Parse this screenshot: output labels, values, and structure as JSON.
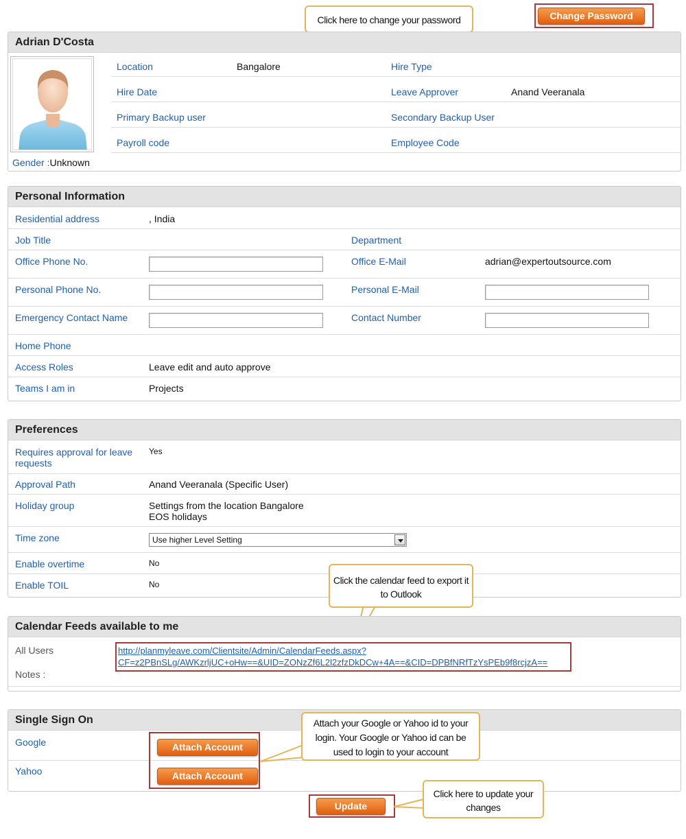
{
  "top": {
    "change_password_label": "Change Password",
    "callout_change_password": "Click here to change your password"
  },
  "profile": {
    "name": "Adrian D'Costa",
    "gender_label": "Gender :",
    "gender_value": "Unknown",
    "rows": [
      {
        "left_label": "Location",
        "left_value": "Bangalore",
        "right_label": "Hire Type",
        "right_value": ""
      },
      {
        "left_label": "Hire Date",
        "left_value": "",
        "right_label": "Leave Approver",
        "right_value": "Anand Veeranala"
      },
      {
        "left_label": "Primary Backup user",
        "left_value": "",
        "right_label": "Secondary Backup User",
        "right_value": ""
      },
      {
        "left_label": "Payroll code",
        "left_value": "",
        "right_label": "Employee Code",
        "right_value": ""
      }
    ]
  },
  "personal": {
    "title": "Personal Information",
    "residential_label": "Residential address",
    "residential_value": ", India",
    "job_title_label": "Job Title",
    "department_label": "Department",
    "office_phone_label": "Office Phone No.",
    "office_email_label": "Office E-Mail",
    "office_email_value": "adrian@expertoutsource.com",
    "personal_phone_label": "Personal Phone No.",
    "personal_email_label": "Personal E-Mail",
    "emergency_label": "Emergency Contact Name",
    "contact_number_label": "Contact Number",
    "home_phone_label": "Home Phone",
    "access_roles_label": "Access Roles",
    "access_roles_value": "Leave edit and auto approve",
    "teams_label": "Teams I am in",
    "teams_value": "Projects"
  },
  "preferences": {
    "title": "Preferences",
    "approval_label_1": "Requires approval for leave",
    "approval_label_2": "requests",
    "approval_value": "Yes",
    "approval_path_label": "Approval Path",
    "approval_path_value": "Anand Veeranala (Specific User)",
    "holiday_label": "Holiday group",
    "holiday_value_1": "Settings from the location Bangalore",
    "holiday_value_2": "EOS holidays",
    "timezone_label": "Time zone",
    "timezone_value": "Use higher Level Setting",
    "overtime_label": "Enable overtime",
    "overtime_value": "No",
    "toil_label": "Enable TOIL",
    "toil_value": "No",
    "callout_calendar": "Click the calendar feed to export it to Outlook"
  },
  "calendar": {
    "title": "Calendar Feeds available to me",
    "all_users_label": "All Users",
    "feed_line_1": "http://planmyleave.com/Clientsite/Admin/CalendarFeeds.aspx?",
    "feed_line_2": "CF=z2PBnSLg/AWKzrljUC+oHw==&UID=ZONzZf6L2l2zfzDkDCw+4A==&CID=DPBfNRfTzYsPEb9f8rcjzA==",
    "notes_label": "Notes :"
  },
  "sso": {
    "title": "Single Sign On",
    "google_label": "Google",
    "yahoo_label": "Yahoo",
    "attach_label": "Attach Account",
    "callout_attach": "Attach your Google or Yahoo id to your login. Your Google or Yahoo id can be used to login to your account"
  },
  "footer": {
    "update_label": "Update",
    "callout_update": "Click here to update your changes"
  },
  "colors": {
    "label_blue": "#1f5fb0",
    "button_orange": "#e8701e",
    "highlight_red": "#a63a3a",
    "callout_border": "#e2b55a",
    "header_gray": "#e3e3e3"
  },
  "icons": {
    "avatar": "default-user-avatar",
    "select_arrow": "chevron-down-icon"
  }
}
